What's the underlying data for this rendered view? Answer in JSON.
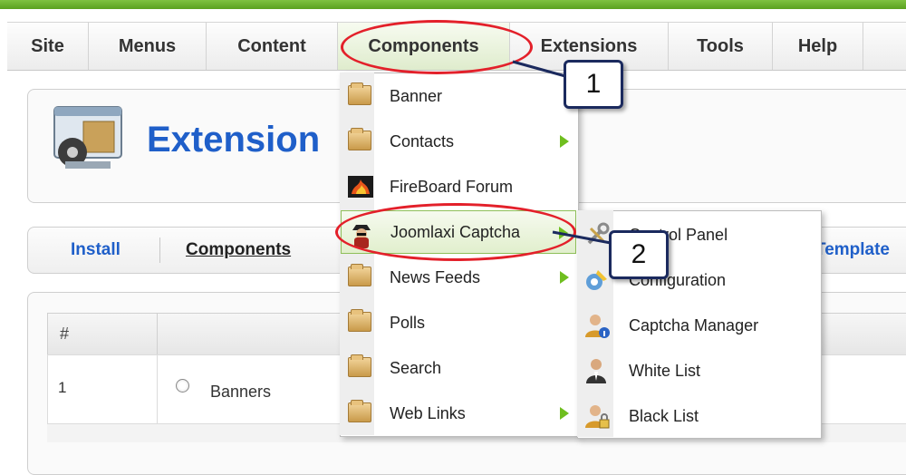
{
  "menu": {
    "items": [
      {
        "label": "Site"
      },
      {
        "label": "Menus"
      },
      {
        "label": "Content"
      },
      {
        "label": "Components"
      },
      {
        "label": "Extensions"
      },
      {
        "label": "Tools"
      },
      {
        "label": "Help"
      }
    ]
  },
  "header": {
    "title": "Extension"
  },
  "submenu_bar": {
    "install": "Install",
    "components": "Components",
    "templates": "Template"
  },
  "table": {
    "col_hash": "#",
    "rows": [
      {
        "num": "1",
        "name": "Banners"
      }
    ]
  },
  "components_dropdown": {
    "items": [
      {
        "label": "Banner",
        "icon": "folder-icon",
        "has_submenu": false
      },
      {
        "label": "Contacts",
        "icon": "folder-icon",
        "has_submenu": true
      },
      {
        "label": "FireBoard Forum",
        "icon": "fireboard-icon",
        "has_submenu": false
      },
      {
        "label": "Joomlaxi Captcha",
        "icon": "joomlaxi-icon",
        "has_submenu": true
      },
      {
        "label": "News Feeds",
        "icon": "folder-icon",
        "has_submenu": true
      },
      {
        "label": "Polls",
        "icon": "folder-icon",
        "has_submenu": false
      },
      {
        "label": "Search",
        "icon": "folder-icon",
        "has_submenu": false
      },
      {
        "label": "Web Links",
        "icon": "folder-icon",
        "has_submenu": true
      }
    ]
  },
  "captcha_submenu": {
    "items": [
      {
        "label": "Control Panel",
        "icon": "tools-icon"
      },
      {
        "label": "Configuration",
        "icon": "gear-icon"
      },
      {
        "label": "Captcha Manager",
        "icon": "user-info-icon"
      },
      {
        "label": "White List",
        "icon": "user-suit-icon"
      },
      {
        "label": "Black List",
        "icon": "user-lock-icon"
      }
    ]
  },
  "callouts": {
    "one": "1",
    "two": "2"
  },
  "colors": {
    "accent_green": "#6fbe1f",
    "title_blue": "#1f5fc9",
    "highlight_red": "#e3202a"
  }
}
